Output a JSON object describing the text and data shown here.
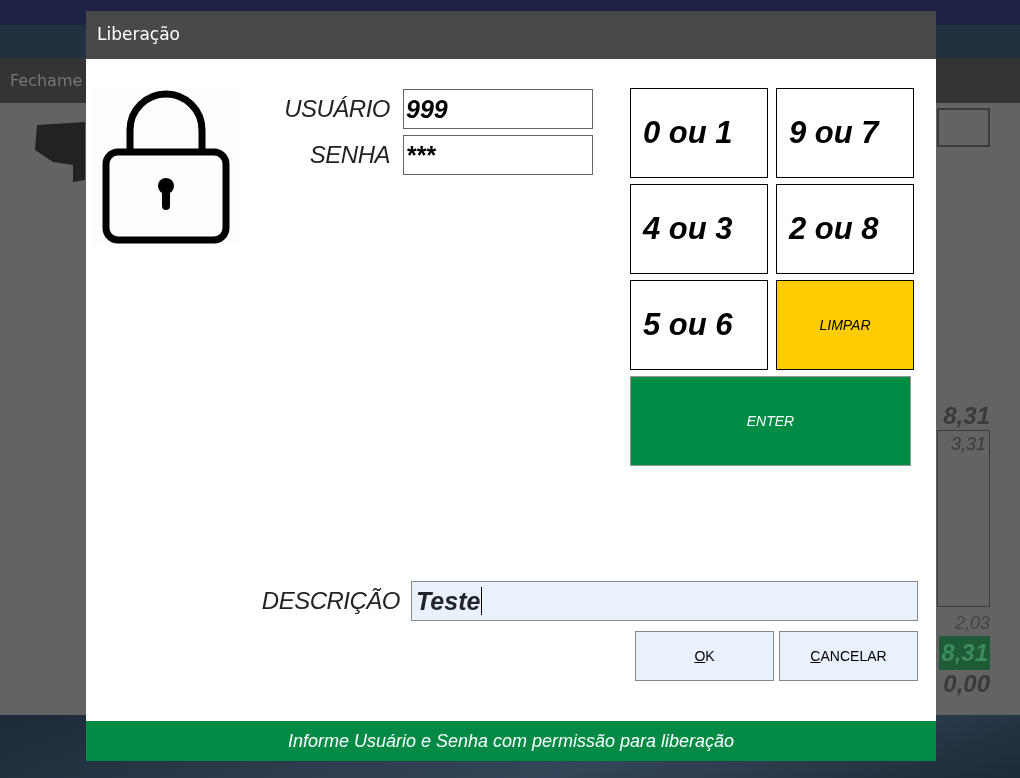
{
  "app": {
    "section_tab": "Fechame",
    "totals": [
      {
        "kind": "bold",
        "text": "8,31"
      },
      {
        "kind": "boxed",
        "text": "3,31"
      },
      {
        "kind": "light",
        "text": "2,03"
      },
      {
        "kind": "highlight",
        "text": "8,31"
      },
      {
        "kind": "bold",
        "text": "0,00"
      }
    ]
  },
  "dialog": {
    "title": "Liberação",
    "fields": [
      {
        "label": "USUÁRIO",
        "value": "999"
      },
      {
        "label": "SENHA",
        "value": "***"
      }
    ],
    "keypad": [
      {
        "kind": "digit",
        "label": "0 ou 1"
      },
      {
        "kind": "digit",
        "label": "9 ou 7"
      },
      {
        "kind": "digit",
        "label": "4 ou 3"
      },
      {
        "kind": "digit",
        "label": "2 ou 8"
      },
      {
        "kind": "digit",
        "label": "5 ou 6"
      },
      {
        "kind": "clear",
        "label": "LIMPAR"
      },
      {
        "kind": "enter",
        "label": "ENTER"
      }
    ],
    "description": {
      "label": "DESCRIÇÃO",
      "value": "Teste",
      "focused": true
    },
    "buttons": [
      "OK",
      "CANCELAR"
    ],
    "message": "Informe Usuário e Senha com permissão para liberação"
  }
}
